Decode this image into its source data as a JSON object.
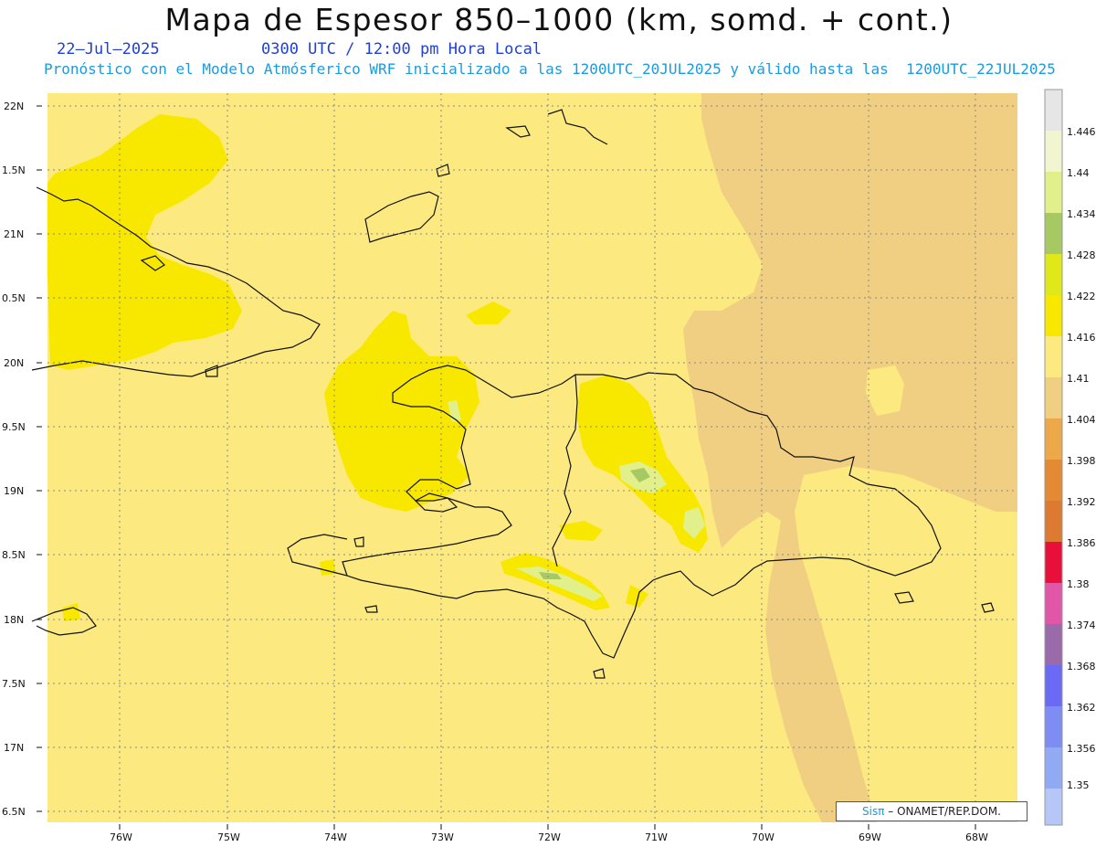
{
  "header": {
    "title": "Mapa de Espesor 850–1000 (km, somd. + cont.)",
    "date": "22–Jul–2025",
    "time": "0300 UTC / 12:00 pm Hora Local",
    "forecast": "Pronóstico con el Modelo Atmósferico WRF inicializado a las 1200UTC_20JUL2025 y válido hasta las  1200UTC_22JUL2025"
  },
  "map": {
    "lat_labels": [
      "22N",
      "1.5N",
      "21N",
      "0.5N",
      "20N",
      "9.5N",
      "19N",
      "8.5N",
      "18N",
      "7.5N",
      "17N",
      "6.5N"
    ],
    "lon_labels": [
      "76W",
      "75W",
      "74W",
      "73W",
      "72W",
      "71W",
      "70W",
      "69W",
      "68W"
    ]
  },
  "legend": {
    "levels": [
      "1.446",
      "1.44",
      "1.434",
      "1.428",
      "1.422",
      "1.416",
      "1.41",
      "1.404",
      "1.398",
      "1.392",
      "1.386",
      "1.38",
      "1.374",
      "1.368",
      "1.362",
      "1.356",
      "1.35"
    ],
    "colors": [
      "#e6e6e6",
      "#f2f5d0",
      "#e1f08a",
      "#a6c964",
      "#e1e81a",
      "#f8e800",
      "#fcea80",
      "#f0cf82",
      "#eda84a",
      "#e48a34",
      "#dc7a32",
      "#e8103a",
      "#e256a8",
      "#9a6aaa",
      "#6a6af4",
      "#7d8df4",
      "#92aaf4",
      "#b6c6f6"
    ]
  },
  "credit": {
    "brand": "Sisπ",
    "text": "– ONAMET/REP.DOM."
  }
}
